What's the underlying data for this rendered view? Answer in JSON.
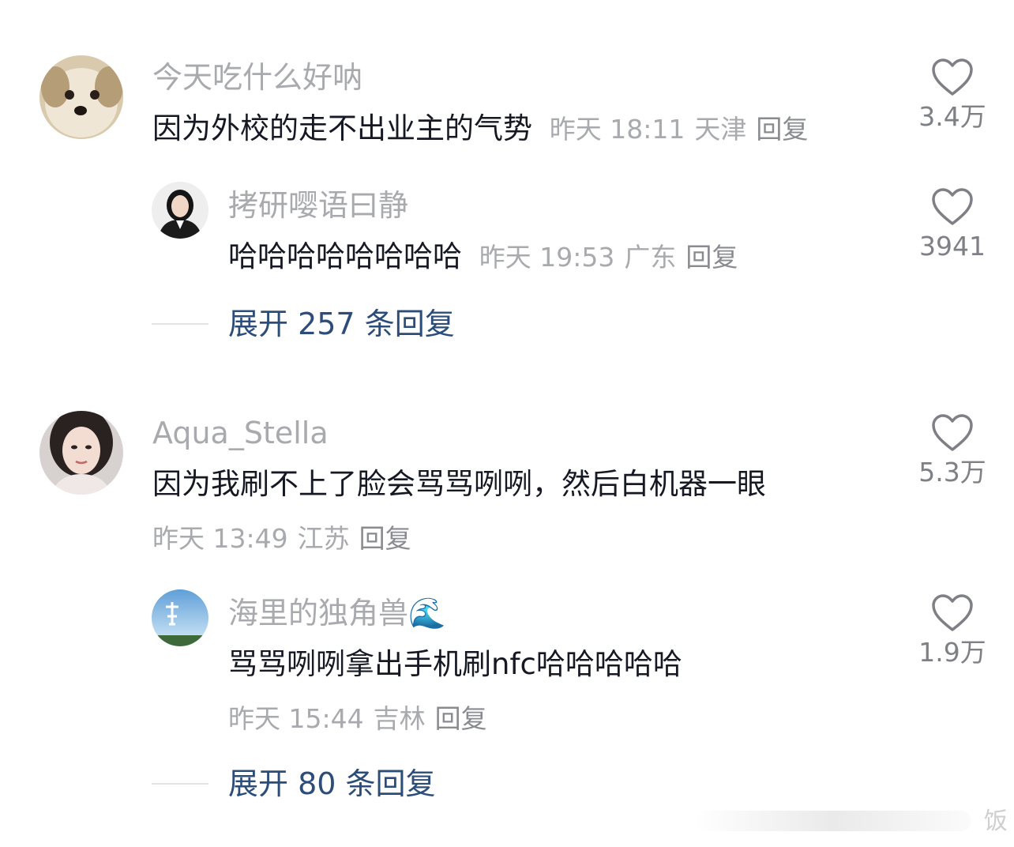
{
  "comments": [
    {
      "user": "今天吃什么好呐",
      "text": "因为外校的走不出业主的气势",
      "time": "昨天 18:11",
      "location": "天津",
      "reply_label": "回复",
      "likes": "3.4万",
      "replies": [
        {
          "user": "拷研嘤语曰静",
          "text": "哈哈哈哈哈哈哈哈",
          "time": "昨天 19:53",
          "location": "广东",
          "reply_label": "回复",
          "likes": "3941"
        }
      ],
      "expand_label": "展开 257 条回复"
    },
    {
      "user": "Aqua_Stella",
      "text": "因为我刷不上了脸会骂骂咧咧，然后白机器一眼",
      "time": "昨天 13:49",
      "location": "江苏",
      "reply_label": "回复",
      "likes": "5.3万",
      "replies": [
        {
          "user": "海里的独角兽🌊",
          "text": "骂骂咧咧拿出手机刷nfc哈哈哈哈哈",
          "time": "昨天 15:44",
          "location": "吉林",
          "reply_label": "回复",
          "likes": "1.9万"
        }
      ],
      "expand_label": "展开 80 条回复"
    }
  ],
  "watermark": "饭",
  "icons": {
    "like": "heart-outline-icon"
  },
  "colors": {
    "username": "#a9aaae",
    "text": "#161823",
    "expand_link": "#2c4d79"
  }
}
